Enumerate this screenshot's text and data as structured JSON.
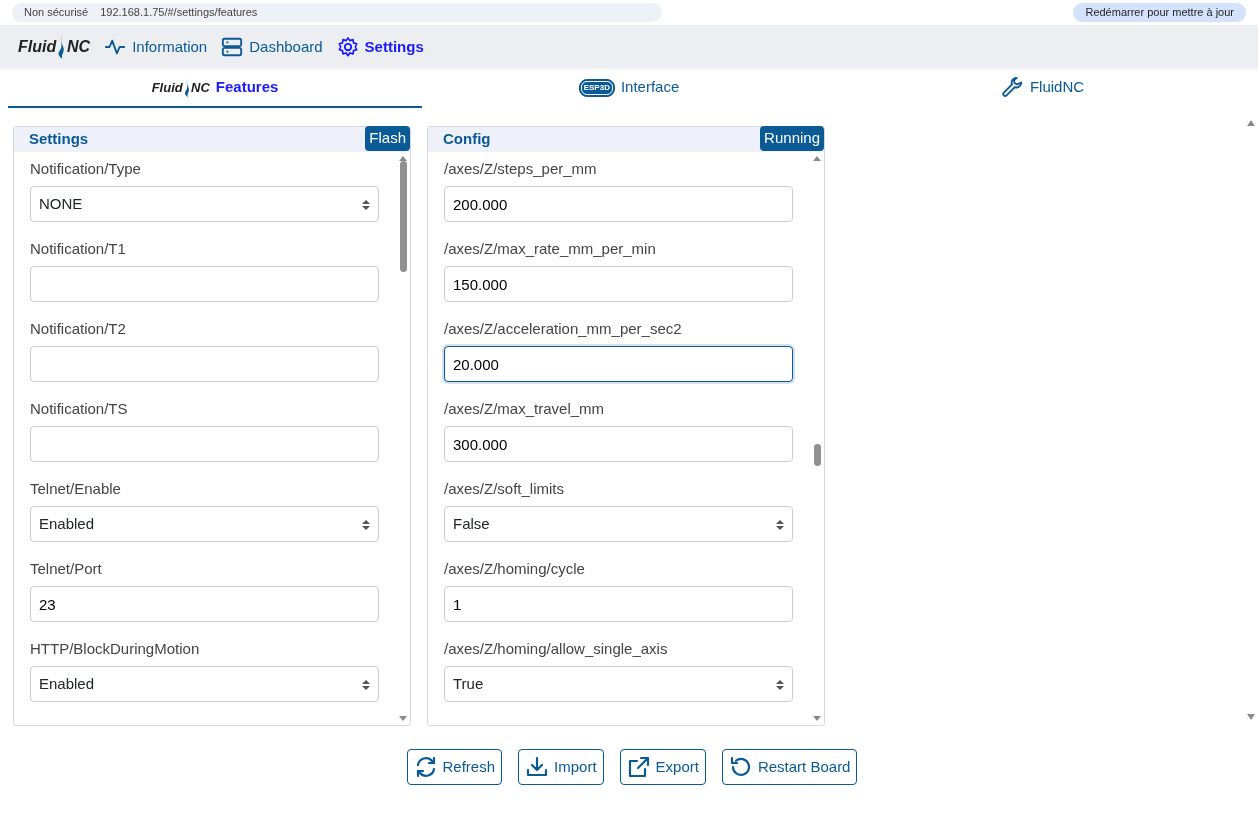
{
  "browser": {
    "security": "Non sécurisé",
    "url": "192.168.1.75/#/settings/features",
    "update_button": "Redémarrer pour mettre à jour"
  },
  "nav": {
    "brand": {
      "left": "Fluid",
      "right": "NC"
    },
    "items": [
      {
        "label": "Information",
        "kind": "pulse",
        "selected": false
      },
      {
        "label": "Dashboard",
        "kind": "server",
        "selected": false
      },
      {
        "label": "Settings",
        "kind": "gear",
        "selected": true
      }
    ]
  },
  "tabs": [
    {
      "kind": "fluidnc",
      "brand_left": "Fluid",
      "brand_right": "NC",
      "label": "Features",
      "selected": true
    },
    {
      "kind": "esp3d",
      "logo": "ESP3D",
      "label": "Interface",
      "selected": false
    },
    {
      "kind": "wrench",
      "label": "FluidNC",
      "selected": false
    }
  ],
  "panels": [
    {
      "title": "Settings",
      "badge": "Flash",
      "fields": [
        {
          "kind": "select",
          "label": "Notification/Type",
          "value": "NONE"
        },
        {
          "kind": "text",
          "label": "Notification/T1"
        },
        {
          "kind": "text",
          "label": "Notification/T2"
        },
        {
          "kind": "text",
          "label": "Notification/TS"
        },
        {
          "kind": "select",
          "label": "Telnet/Enable",
          "value": "Enabled"
        },
        {
          "kind": "text",
          "label": "Telnet/Port",
          "value": "23"
        },
        {
          "kind": "select",
          "label": "HTTP/BlockDuringMotion",
          "value": "Enabled"
        }
      ]
    },
    {
      "title": "Config",
      "badge": "Running",
      "fields": [
        {
          "kind": "text",
          "label": "/axes/Z/steps_per_mm",
          "value": "200.000"
        },
        {
          "kind": "text",
          "label": "/axes/Z/max_rate_mm_per_min",
          "value": "150.000"
        },
        {
          "kind": "text",
          "label": "/axes/Z/acceleration_mm_per_sec2",
          "value": "20.000",
          "focused": true
        },
        {
          "kind": "text",
          "label": "/axes/Z/max_travel_mm",
          "value": "300.000"
        },
        {
          "kind": "select",
          "label": "/axes/Z/soft_limits",
          "value": "False"
        },
        {
          "kind": "text",
          "label": "/axes/Z/homing/cycle",
          "value": "1"
        },
        {
          "kind": "select",
          "label": "/axes/Z/homing/allow_single_axis",
          "value": "True"
        }
      ]
    }
  ],
  "actions": [
    {
      "label": "Refresh",
      "kind": "refresh"
    },
    {
      "label": "Import",
      "kind": "import"
    },
    {
      "label": "Export",
      "kind": "export"
    },
    {
      "label": "Restart Board",
      "kind": "restart"
    }
  ]
}
